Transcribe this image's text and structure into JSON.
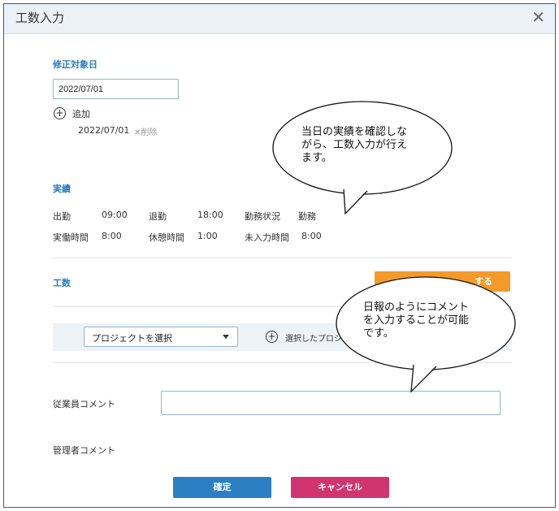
{
  "window": {
    "title": "工数入力",
    "close_glyph": "✕"
  },
  "date_section": {
    "label": "修正対象日",
    "date_value": "2022/07/01",
    "add_label": "追加",
    "added_date": "2022/07/01",
    "delete_label": "✕削除"
  },
  "results": {
    "label": "実績",
    "row1": {
      "in_label": "出勤",
      "in_value": "09:00",
      "out_label": "退勤",
      "out_value": "18:00",
      "status_label": "勤務状況",
      "status_value": "勤務"
    },
    "row2": {
      "work_label": "実働時間",
      "work_value": "8:00",
      "break_label": "休憩時間",
      "break_value": "1:00",
      "unentered_label": "未入力時間",
      "unentered_value": "8:00"
    }
  },
  "manhours": {
    "label": "工数",
    "orange_button_label": "する",
    "project_select_value": "プロジェクトを選択",
    "add_project_label": "選択したプロジ"
  },
  "comments": {
    "employee_label": "従業員コメント",
    "employee_value": "",
    "manager_label": "管理者コメント"
  },
  "footer": {
    "confirm_label": "確定",
    "cancel_label": "キャンセル"
  },
  "callouts": {
    "bubble1": "当日の実績を確認しな\nがら、工数入力が行え\nます。",
    "bubble2": "日報のようにコメント\nを入力することが可能\nです。"
  },
  "colors": {
    "accent_blue": "#2c7fc2",
    "orange": "#f39a2b",
    "cancel_pink": "#d23470",
    "label_blue": "#2a7cc0"
  }
}
